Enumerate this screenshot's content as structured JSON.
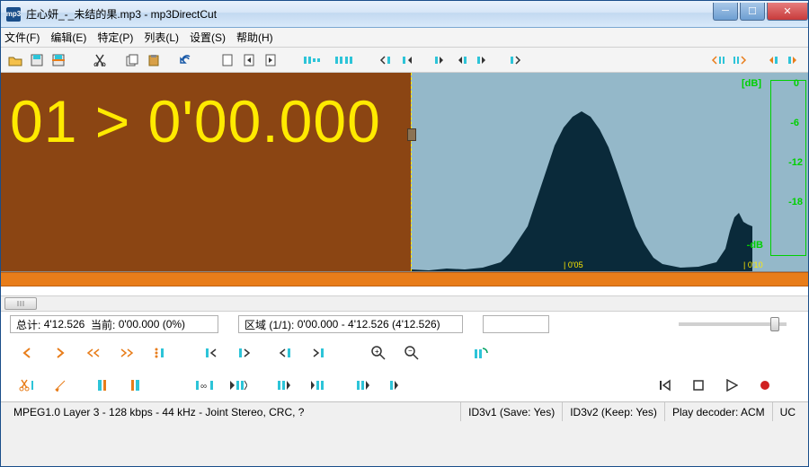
{
  "window": {
    "title": "庄心妍_-_未结的果.mp3 - mp3DirectCut",
    "app_icon_text": "mp3"
  },
  "menu": {
    "file": "文件(F)",
    "edit": "编辑(E)",
    "special": "特定(P)",
    "list": "列表(L)",
    "settings": "设置(S)",
    "help": "帮助(H)"
  },
  "time_display": "01 > 0'00.000",
  "db": {
    "label": "[dB]",
    "v0": "0",
    "v6": "-6",
    "v12": "-12",
    "v18": "-18",
    "vpeak": "-dB"
  },
  "ticks": {
    "t1": "| 0'05",
    "t2": "| 0'10"
  },
  "info": {
    "total_label": "总计:",
    "total_value": "4'12.526",
    "current_label": "当前:",
    "current_value": "0'00.000  (0%)",
    "region_label": "区域 (1/1):",
    "region_value": "0'00.000 - 4'12.526 (4'12.526)"
  },
  "status": {
    "codec": "MPEG1.0 Layer 3 - 128 kbps - 44 kHz - Joint Stereo, CRC, ?",
    "id3v1": "ID3v1 (Save: Yes)",
    "id3v2": "ID3v2 (Keep: Yes)",
    "decoder": "Play decoder: ACM",
    "uc": "UC"
  },
  "colors": {
    "accent_cyan": "#2dc4d8",
    "accent_orange": "#e87d1a",
    "wave_dark": "#0a2a3a"
  }
}
